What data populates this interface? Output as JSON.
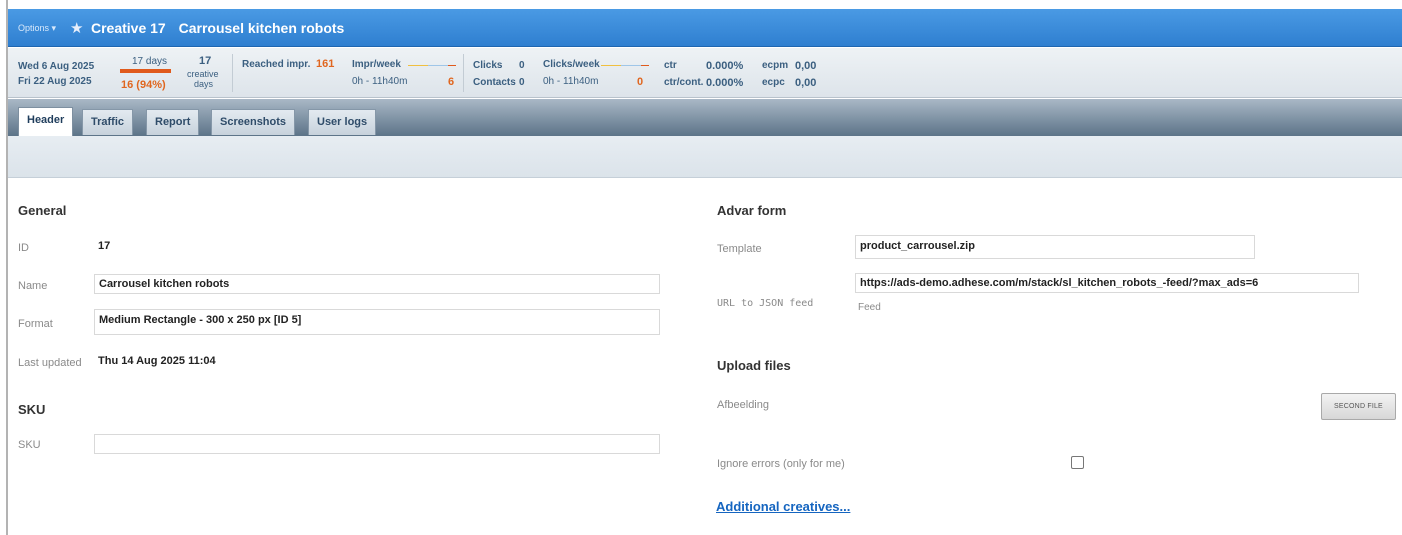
{
  "title_bar": {
    "options_label": "Options ▾",
    "star_icon": "star-icon",
    "creative_number": "Creative 17",
    "creative_name": "Carrousel kitchen robots"
  },
  "stats": {
    "start_date": "Wed 6 Aug 2025",
    "end_date": "Fri 22 Aug 2025",
    "days_total": "17 days",
    "days_elapsed": "16 (94%)",
    "days_progress": 0.94,
    "creative_days_count": "17",
    "creative_days_label1": "creative",
    "creative_days_label2": "days",
    "reached_impr_label": "Reached impr.",
    "reached_impr_value": "161",
    "impr_week_label": "Impr/week",
    "impr_week_time": "0h - 11h40m",
    "impr_week_value": "6",
    "clicks_label": "Clicks",
    "clicks_value": "0",
    "contacts_label": "Contacts",
    "contacts_value": "0",
    "clicks_week_label": "Clicks/week",
    "clicks_week_time": "0h - 11h40m",
    "clicks_week_value": "0",
    "ctr_label": "ctr",
    "ctr_value": "0.000%",
    "ctr_cont_label": "ctr/cont.",
    "ctr_cont_value": "0.000%",
    "ecpm_label": "ecpm",
    "ecpm_value": "0,00",
    "ecpc_label": "ecpc",
    "ecpc_value": "0,00"
  },
  "tabs": [
    {
      "label": "Header",
      "active": true
    },
    {
      "label": "Traffic",
      "active": false
    },
    {
      "label": "Report",
      "active": false
    },
    {
      "label": "Screenshots",
      "active": false
    },
    {
      "label": "User logs",
      "active": false
    }
  ],
  "general": {
    "heading": "General",
    "id_label": "ID",
    "id_value": "17",
    "name_label": "Name",
    "name_value": "Carrousel kitchen robots",
    "format_label": "Format",
    "format_value": "Medium Rectangle - 300 x 250 px [ID 5]",
    "updated_label": "Last updated",
    "updated_value": "Thu 14 Aug 2025 11:04"
  },
  "sku": {
    "heading": "SKU",
    "sku_label": "SKU",
    "sku_value": ""
  },
  "advar": {
    "heading": "Advar form",
    "template_label": "Template",
    "template_value": "product_carrousel.zip",
    "url_label": "URL to JSON feed",
    "url_value": "https://ads-demo.adhese.com/m/stack/sl_kitchen_robots_-feed/?max_ads=6",
    "feed_hint": "Feed"
  },
  "upload": {
    "heading": "Upload files",
    "afbeelding_label": "Afbeelding",
    "second_file_button": "SECOND FILE",
    "ignore_errors_label": "Ignore errors (only for me)",
    "ignore_errors_checked": false,
    "additional_link": "Additional creatives..."
  },
  "colors": {
    "titlebar": "#3a8ad8",
    "accent_orange": "#e0661f",
    "link": "#1565c0"
  }
}
